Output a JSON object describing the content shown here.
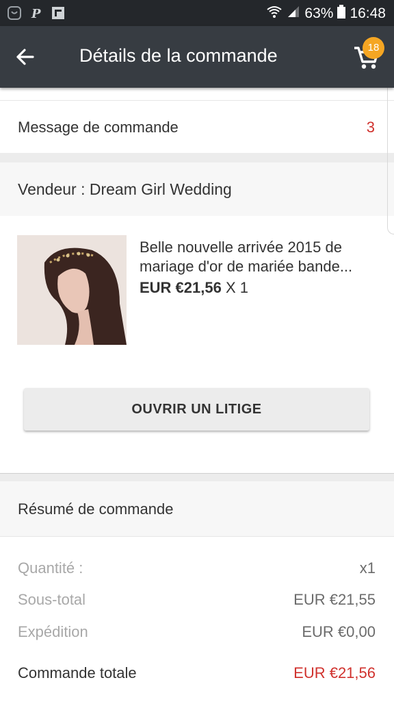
{
  "status_bar": {
    "battery": "63%",
    "time": "16:48"
  },
  "app_bar": {
    "title": "Détails de la commande",
    "cart_count": "18"
  },
  "order": {
    "message_label": "Message de commande",
    "message_count": "3",
    "seller_label": "Vendeur : Dream Girl Wedding",
    "product": {
      "title": "Belle nouvelle arrivée 2015 de mariage d'or de mariée bande...",
      "price": "EUR €21,56",
      "quantity": "X 1"
    },
    "dispute_button": "OUVRIR UN LITIGE"
  },
  "summary": {
    "title": "Résumé de commande",
    "rows": [
      {
        "label": "Quantité :",
        "value": "x1"
      },
      {
        "label": "Sous-total",
        "value": "EUR €21,55"
      },
      {
        "label": "Expédition",
        "value": "EUR €0,00"
      }
    ],
    "total_label": "Commande totale",
    "total_value": "EUR €21,56"
  },
  "colors": {
    "app_bar": "#373c42",
    "status_bar": "#24272b",
    "badge": "#f5a623",
    "accent_red": "#d0312d"
  },
  "icons": [
    "notification-icon",
    "p-icon",
    "flipboard-icon",
    "wifi-icon",
    "signal-icon",
    "battery-icon",
    "back-arrow-icon",
    "cart-icon"
  ]
}
